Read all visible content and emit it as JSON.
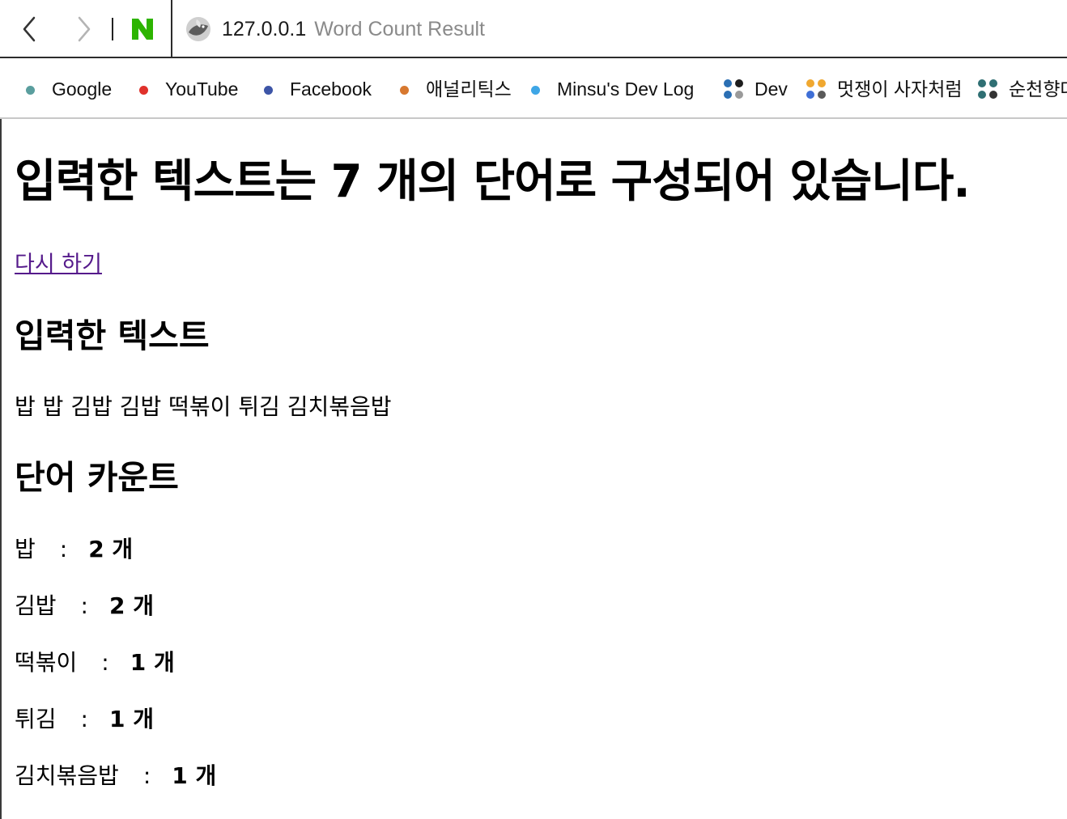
{
  "browser": {
    "url_host": "127.0.0.1",
    "tab_title": "Word Count Result",
    "bookmarks": [
      {
        "label": "Google",
        "color": "#5a9e9e",
        "icon": "dot"
      },
      {
        "label": "YouTube",
        "color": "#e0312b",
        "icon": "dot"
      },
      {
        "label": "Facebook",
        "color": "#3d55a7",
        "icon": "dot"
      },
      {
        "label": "애널리틱스",
        "color": "#d7782f",
        "icon": "dot"
      },
      {
        "label": "Minsu's Dev Log",
        "color": "#3ea6e6",
        "icon": "dot"
      },
      {
        "label": "Dev",
        "colors": [
          "#2b6fb3",
          "#1d1d1d",
          "#2b6fb3",
          "#9a9a9a"
        ],
        "icon": "folder-grid"
      },
      {
        "label": "멋쟁이 사자처럼",
        "colors": [
          "#f0a830",
          "#f0a830",
          "#3f6fd6",
          "#5a5a5a"
        ],
        "icon": "folder-grid"
      },
      {
        "label": "순천향대",
        "colors": [
          "#2f6f73",
          "#2f6f73",
          "#2f6f73",
          "#333333"
        ],
        "icon": "folder-grid"
      }
    ]
  },
  "page": {
    "heading": "입력한 텍스트는 7 개의 단어로 구성되어 있습니다.",
    "retry_link": "다시 하기",
    "input_section_title": "입력한 텍스트",
    "input_text": "밥 밥 김밥 김밥 떡볶이 튀김 김치볶음밥",
    "count_section_title": "단어 카운트",
    "separator": ":",
    "counts": [
      {
        "word": "밥",
        "count": "2 개"
      },
      {
        "word": "김밥",
        "count": "2 개"
      },
      {
        "word": "떡볶이",
        "count": "1 개"
      },
      {
        "word": "튀김",
        "count": "1 개"
      },
      {
        "word": "김치볶음밥",
        "count": "1 개"
      }
    ]
  },
  "colors": {
    "link_visited": "#551a8b",
    "naver_green": "#2db400",
    "address_title_gray": "#8a8a8a"
  }
}
